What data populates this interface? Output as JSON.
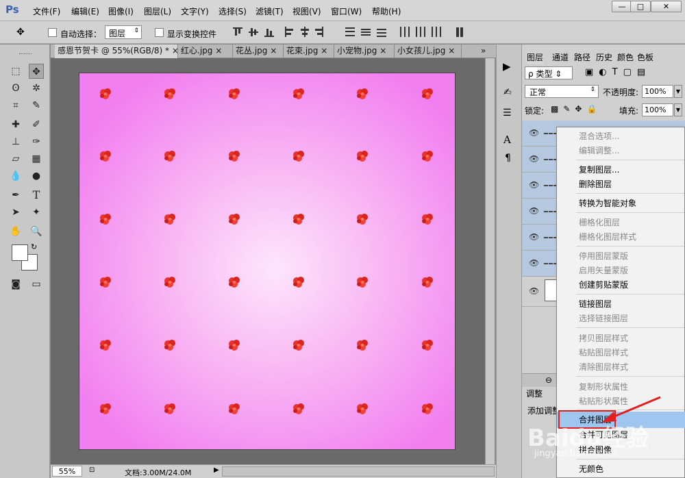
{
  "app": {
    "logo": "Ps"
  },
  "menu": [
    "文件(F)",
    "编辑(E)",
    "图像(I)",
    "图层(L)",
    "文字(Y)",
    "选择(S)",
    "滤镜(T)",
    "视图(V)",
    "窗口(W)",
    "帮助(H)"
  ],
  "window_controls": {
    "minimize": "—",
    "maximize": "□",
    "close": "✕"
  },
  "options": {
    "auto_select_label": "自动选择：",
    "auto_select_value": "图层",
    "show_transform_label": "显示变换控件"
  },
  "tabs": [
    "感恩节贺卡 @ 55%(RGB/8) *",
    "红心.jpg",
    "花丛.jpg",
    "花束.jpg",
    "小宠物.jpg",
    "小女孩儿.jpg"
  ],
  "tab_overflow": "»",
  "status": {
    "zoom": "55%",
    "doc": "文档:3.00M/24.0M"
  },
  "layers_panel": {
    "tabs": [
      "图层",
      "通道",
      "路径",
      "历史",
      "颜色",
      "色板"
    ],
    "filter_kind": "类型",
    "blend_mode": "正常",
    "opacity_label": "不透明度:",
    "opacity_value": "100%",
    "lock_label": "锁定:",
    "fill_label": "填充:",
    "fill_value": "100%"
  },
  "adjust_panel": {
    "tab": "调整",
    "label": "添加调整"
  },
  "context_menu": [
    {
      "label": "混合选项...",
      "enabled": false
    },
    {
      "label": "编辑调整...",
      "enabled": false
    },
    {
      "label": "复制图层...",
      "enabled": true
    },
    {
      "label": "删除图层",
      "enabled": true
    },
    {
      "label": "转换为智能对象",
      "enabled": true
    },
    {
      "label": "栅格化图层",
      "enabled": false
    },
    {
      "label": "栅格化图层样式",
      "enabled": false
    },
    {
      "label": "停用图层蒙版",
      "enabled": false
    },
    {
      "label": "启用矢量蒙版",
      "enabled": false
    },
    {
      "label": "创建剪贴蒙版",
      "enabled": true
    },
    {
      "label": "链接图层",
      "enabled": true
    },
    {
      "label": "选择链接图层",
      "enabled": false
    },
    {
      "label": "拷贝图层样式",
      "enabled": false
    },
    {
      "label": "粘贴图层样式",
      "enabled": false
    },
    {
      "label": "清除图层样式",
      "enabled": false
    },
    {
      "label": "复制形状属性",
      "enabled": false
    },
    {
      "label": "粘贴形状属性",
      "enabled": false
    },
    {
      "label": "合并图层",
      "enabled": true,
      "highlighted": true
    },
    {
      "label": "合并可见图层",
      "enabled": true
    },
    {
      "label": "拼合图像",
      "enabled": true
    },
    {
      "label": "无颜色",
      "enabled": true
    }
  ],
  "watermark": {
    "text": "Baidu经验",
    "url": "jingyan.baidu.com"
  },
  "colors": {
    "canvas_edge": "#f27ff0",
    "canvas_center": "#fde6fc",
    "highlight": "#9ec6ef",
    "annotation": "#e02020"
  }
}
